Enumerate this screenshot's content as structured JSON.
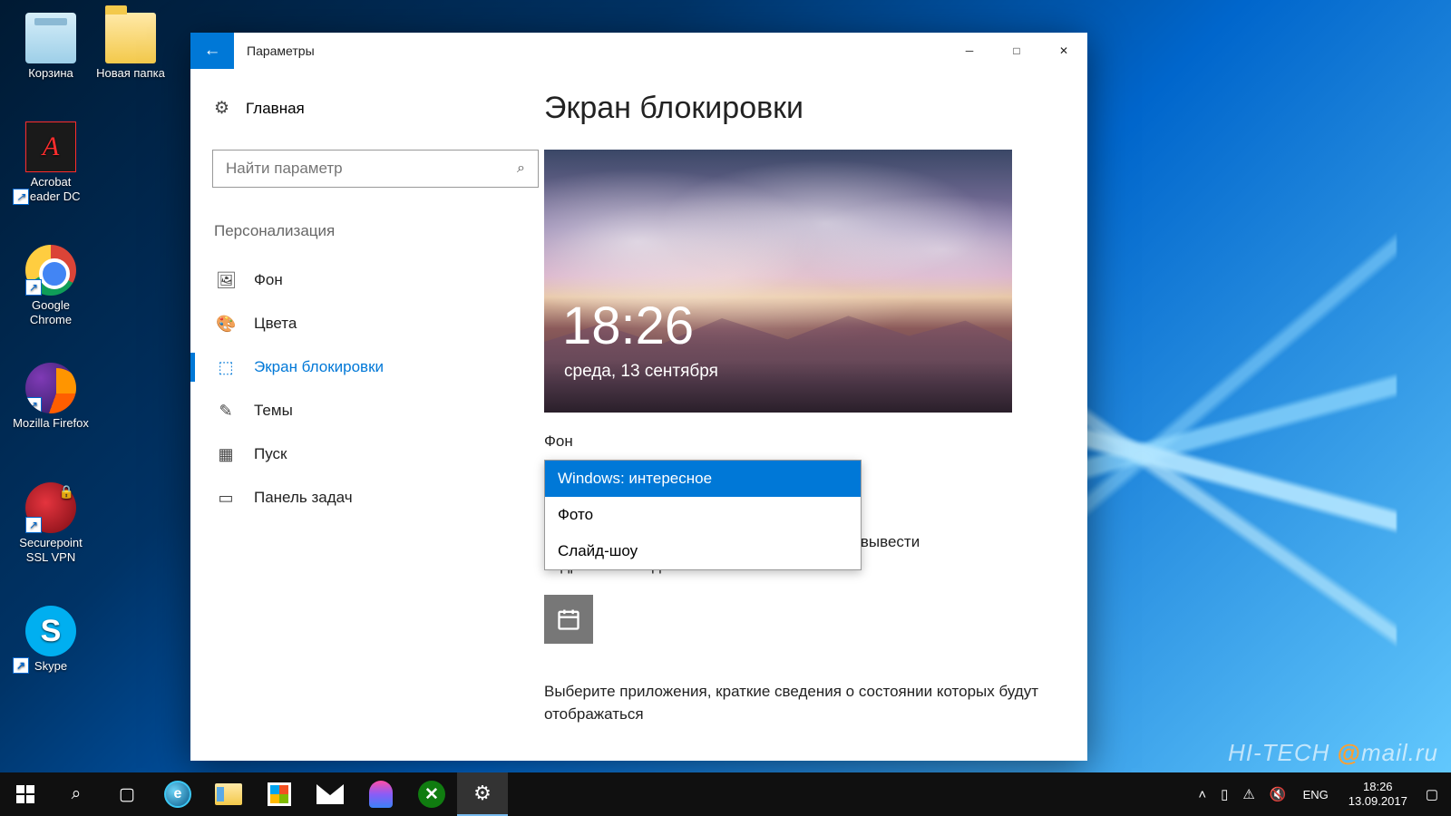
{
  "desktop": {
    "icons": [
      {
        "label": "Корзина"
      },
      {
        "label": "Новая папка"
      },
      {
        "label": "Acrobat Reader DC"
      },
      {
        "label": "Google Chrome"
      },
      {
        "label": "Mozilla Firefox"
      },
      {
        "label": "Securepoint SSL VPN"
      },
      {
        "label": "Skype"
      }
    ]
  },
  "window": {
    "title": "Параметры",
    "sidebar": {
      "home": "Главная",
      "search_placeholder": "Найти параметр",
      "category": "Персонализация",
      "items": [
        {
          "label": "Фон"
        },
        {
          "label": "Цвета"
        },
        {
          "label": "Экран блокировки"
        },
        {
          "label": "Темы"
        },
        {
          "label": "Пуск"
        },
        {
          "label": "Панель задач"
        }
      ]
    },
    "content": {
      "heading": "Экран блокировки",
      "preview": {
        "time": "18:26",
        "date": "среда, 13 сентября"
      },
      "bg_label": "Фон",
      "bg_options": [
        {
          "label": "Windows: интересное",
          "selected": true
        },
        {
          "label": "Фото"
        },
        {
          "label": "Слайд-шоу"
        }
      ],
      "detailed_app_hint": "жно вывести подробные сведения о состоянии",
      "brief_apps_label": "Выберите приложения, краткие сведения о состоянии которых будут отображаться"
    }
  },
  "taskbar": {
    "lang": "ENG",
    "time": "18:26",
    "date": "13.09.2017"
  },
  "watermark": {
    "left": "HI-TECH",
    "right": "mail.ru"
  }
}
